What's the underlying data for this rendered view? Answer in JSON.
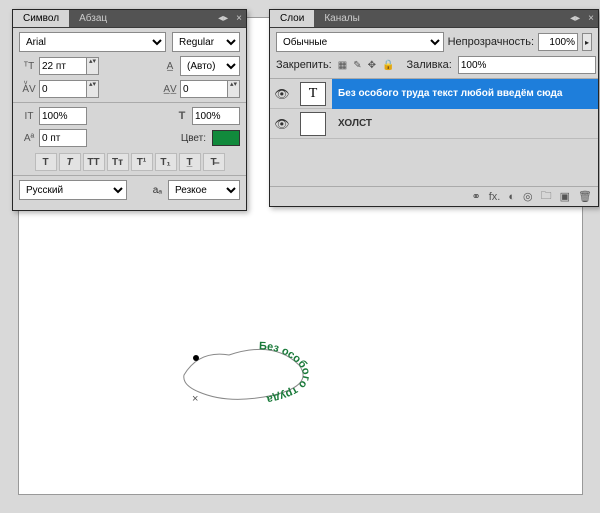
{
  "char": {
    "tab_symbol": "Символ",
    "tab_paragraph": "Абзац",
    "font_family": "Arial",
    "font_style": "Regular",
    "font_size": "22 пт",
    "leading": "(Авто)",
    "kerning": "0",
    "tracking": "0",
    "v_scale": "100%",
    "h_scale": "100%",
    "baseline": "0 пт",
    "color_label": "Цвет:",
    "color": "#118a3c",
    "language": "Русский",
    "aa_label": "aₐ",
    "antialias": "Резкое",
    "buttons": [
      "T",
      "T",
      "TT",
      "Tᴛ",
      "T¹",
      "T₁",
      "T̲",
      "T̶"
    ]
  },
  "layers": {
    "tab_layers": "Слои",
    "tab_channels": "Каналы",
    "blend_mode": "Обычные",
    "opacity_label": "Непрозрачность:",
    "opacity": "100%",
    "lock_label": "Закрепить:",
    "fill_label": "Заливка:",
    "fill": "100%",
    "items": [
      {
        "thumb": "T",
        "name": "Без особого труда текст любой введём сюда",
        "selected": true
      },
      {
        "thumb": "",
        "name": "ХОЛСТ",
        "selected": false
      }
    ]
  },
  "canvas": {
    "path_text": "Без особого труда"
  }
}
